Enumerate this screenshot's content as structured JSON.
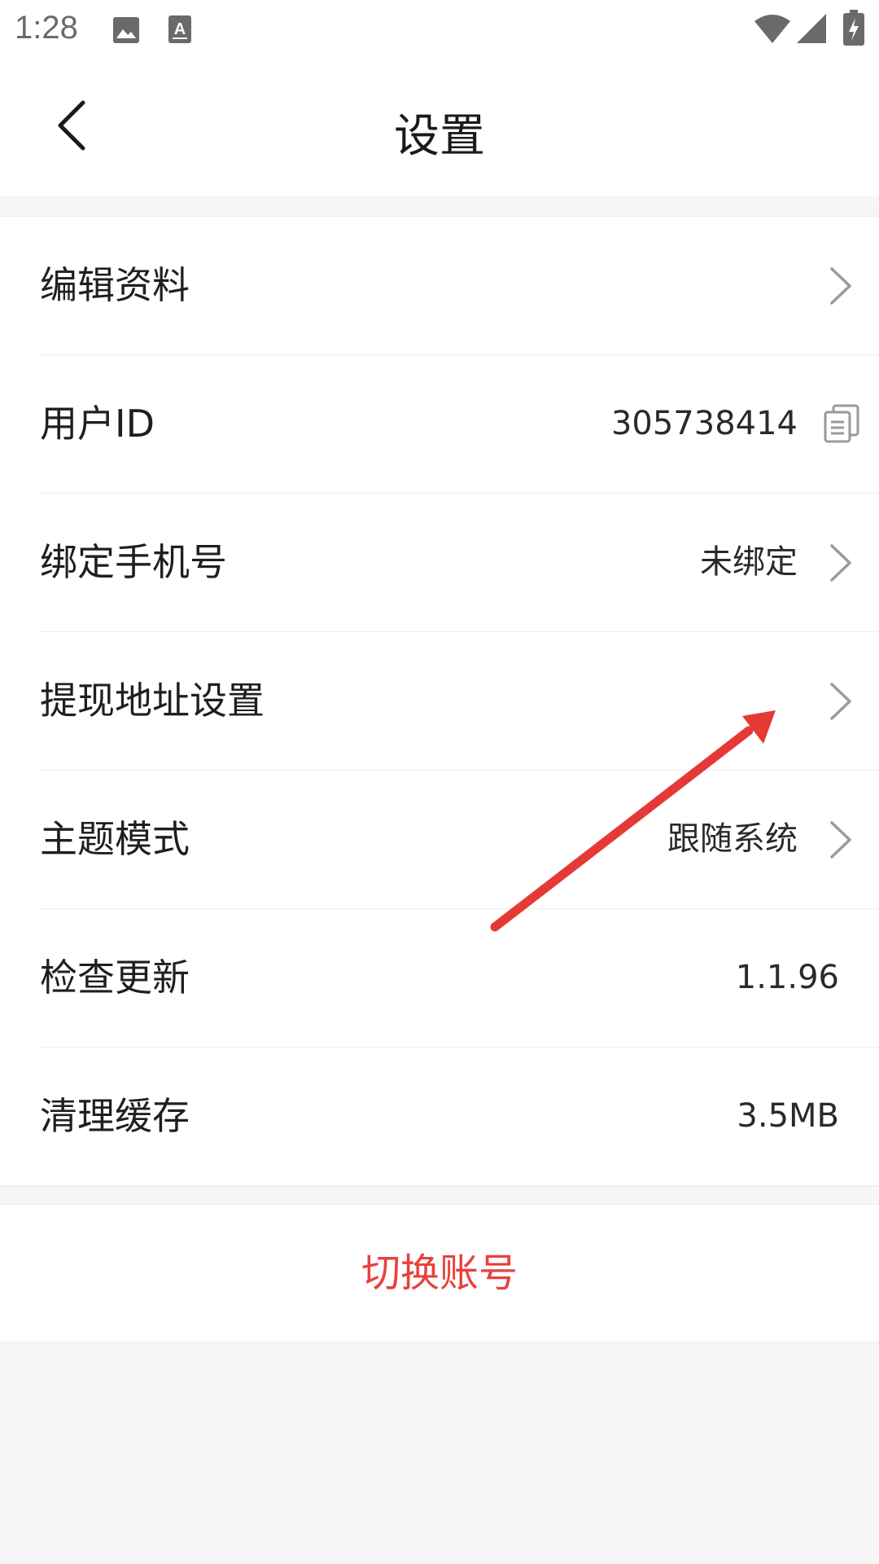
{
  "status_bar": {
    "time": "1:28",
    "icons": [
      "image-icon",
      "a-notification-icon",
      "wifi-icon",
      "signal-icon",
      "battery-charging-icon"
    ]
  },
  "header": {
    "title": "设置",
    "back_icon": "chevron-left-icon"
  },
  "settings": {
    "items": [
      {
        "label": "编辑资料",
        "value": "",
        "trailing": "chevron-right-icon"
      },
      {
        "label": "用户ID",
        "value": "305738414",
        "trailing": "copy-icon"
      },
      {
        "label": "绑定手机号",
        "value": "未绑定",
        "trailing": "chevron-right-icon"
      },
      {
        "label": "提现地址设置",
        "value": "",
        "trailing": "chevron-right-icon"
      },
      {
        "label": "主题模式",
        "value": "跟随系统",
        "trailing": "chevron-right-icon"
      },
      {
        "label": "检查更新",
        "value": "1.1.96",
        "trailing": ""
      },
      {
        "label": "清理缓存",
        "value": "3.5MB",
        "trailing": ""
      }
    ]
  },
  "actions": {
    "switch_account": "切换账号"
  },
  "colors": {
    "accent_red": "#e8413d",
    "background": "#f5f6f5",
    "card": "#ffffff",
    "divider": "#eeeeee"
  }
}
